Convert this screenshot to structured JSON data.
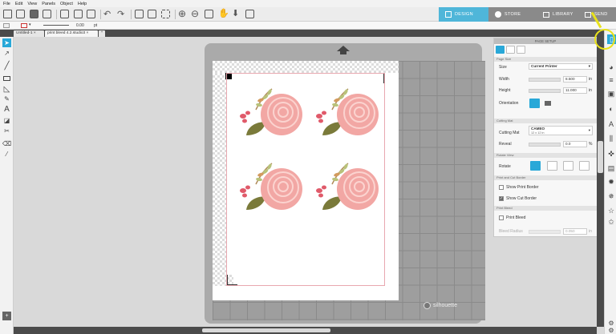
{
  "menu": [
    "File",
    "Edit",
    "View",
    "Panels",
    "Object",
    "Help"
  ],
  "nav_tabs": [
    {
      "label": "DESIGN",
      "active": true
    },
    {
      "label": "STORE",
      "active": false
    },
    {
      "label": "LIBRARY",
      "active": false
    },
    {
      "label": "SEND",
      "active": false
    }
  ],
  "options": {
    "line_width": "0.00",
    "line_unit": "pt"
  },
  "doc_tabs": [
    "Untitled-1",
    "print bleed 4.2.studio3"
  ],
  "brand": "silhouette",
  "panel": {
    "title": "PAGE SETUP",
    "sections": {
      "page_size": "Page Size",
      "cutting_mat": "Cutting Mat",
      "rotate_view": "Rotate View",
      "print_cut_border": "Print and Cut Border",
      "print_bleed": "Print Bleed"
    },
    "size_label": "Size",
    "size_value": "Current Printer",
    "width_label": "Width",
    "width_value": "8.500",
    "height_label": "Height",
    "height_value": "11.000",
    "unit": "in",
    "orientation_label": "Orientation",
    "cutting_mat_label": "Cutting Mat",
    "cutting_mat_value": "CAMEO",
    "cutting_mat_sub": "12 x 12 in",
    "reveal_label": "Reveal",
    "reveal_value": "0.0",
    "reveal_unit": "%",
    "rotate_label": "Rotate",
    "show_print_border": "Show Print Border",
    "show_print_border_checked": false,
    "show_cut_border": "Show Cut Border",
    "show_cut_border_checked": true,
    "print_bleed": "Print Bleed",
    "print_bleed_checked": false,
    "bleed_radius_label": "Bleed Radius",
    "bleed_radius_value": "0.050",
    "bleed_unit": "in"
  },
  "colors": {
    "accent": "#29a8d8",
    "active_tab": "#4fb6d9",
    "tab_bar": "#8a8a8a",
    "flower_pink": "#f2a7a4",
    "leaf_olive": "#7a7a3a"
  }
}
